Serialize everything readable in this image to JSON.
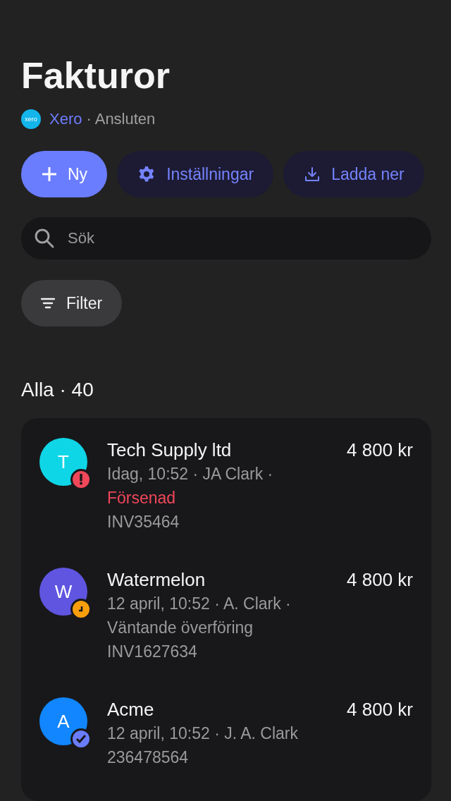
{
  "title": "Fakturor",
  "connection": {
    "logo_text": "xero",
    "service": "Xero",
    "status": "· Ansluten"
  },
  "actions": [
    {
      "kind": "add",
      "label": "Ny"
    },
    {
      "kind": "settings",
      "label": "Inställningar"
    },
    {
      "kind": "download",
      "label": "Ladda ner"
    }
  ],
  "search": {
    "placeholder": "Sök"
  },
  "filter": {
    "label": "Filter"
  },
  "section_title": "Alla · 40",
  "invoices": [
    {
      "initial": "T",
      "color": "#0fd6e6",
      "name": "Tech Supply ltd",
      "amount": "4 800 kr",
      "meta": "Idag, 10:52 · JA Clark ·",
      "kind": "overdue",
      "status": "Försenad",
      "reference": "INV35464"
    },
    {
      "initial": "W",
      "color": "#5f55e0",
      "name": "Watermelon",
      "amount": "4 800 kr",
      "meta": "12 april, 10:52 · A. Clark ·",
      "kind": "pending",
      "status": "Väntande överföring",
      "reference": "INV1627634"
    },
    {
      "initial": "A",
      "color": "#1186ff",
      "name": "Acme",
      "amount": "4 800 kr",
      "meta": "12 april, 10:52 · J. A. Clark",
      "kind": "paid",
      "reference": "236478564"
    }
  ]
}
